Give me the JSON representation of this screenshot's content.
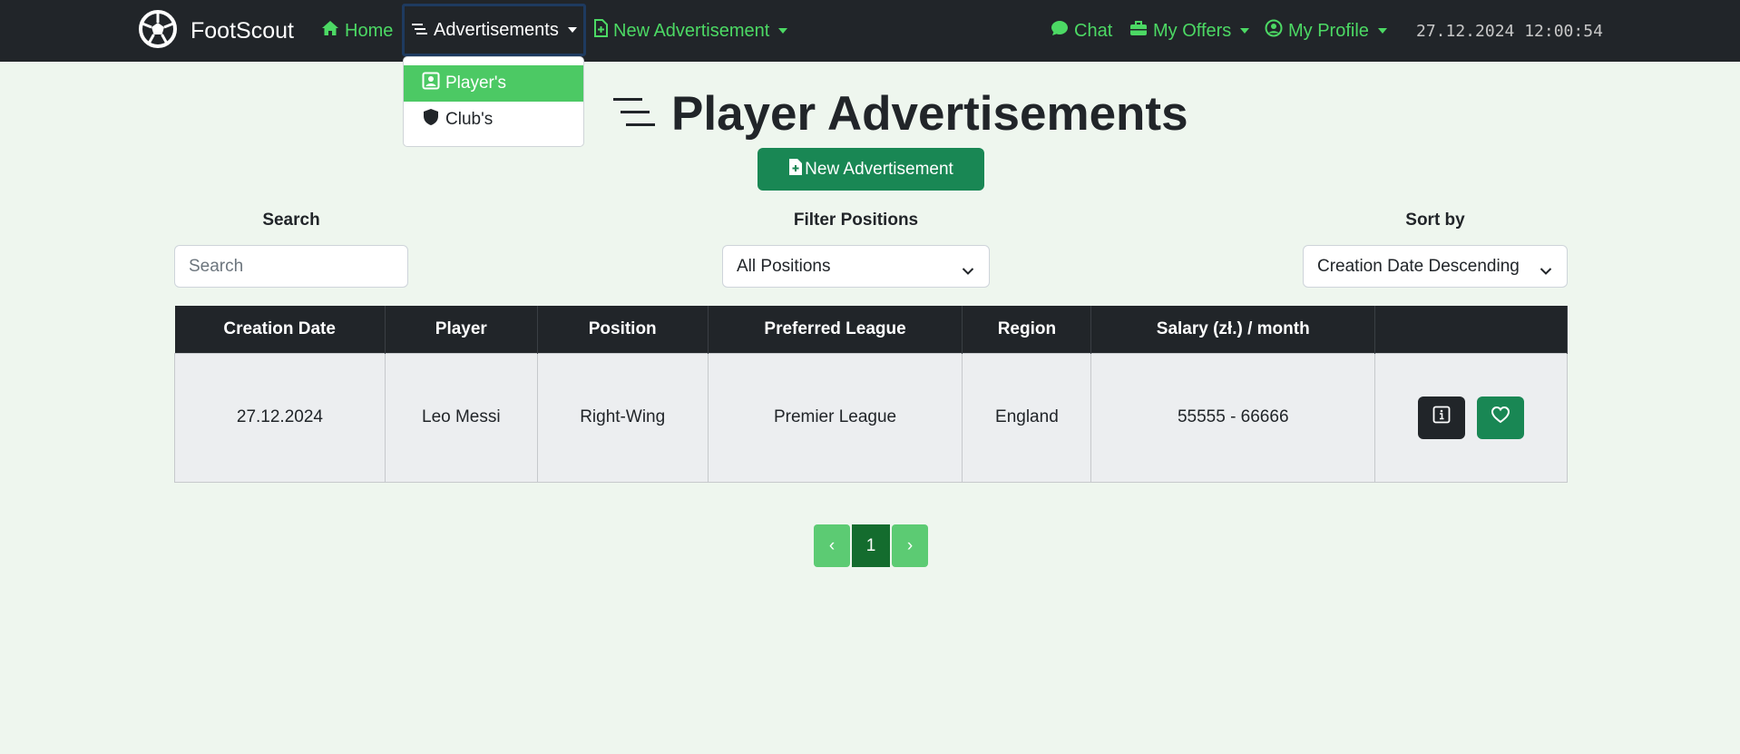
{
  "app": {
    "brand": "FootScout",
    "clock": "27.12.2024 12:00:54"
  },
  "nav": {
    "home": "Home",
    "advertisements": "Advertisements",
    "new_advertisement": "New Advertisement",
    "chat": "Chat",
    "my_offers": "My Offers",
    "my_profile": "My Profile"
  },
  "dropdown": {
    "items": [
      {
        "label": "Player's",
        "active": true
      },
      {
        "label": "Club's",
        "active": false
      }
    ]
  },
  "page": {
    "title": "Player Advertisements",
    "new_button": "New Advertisement"
  },
  "filters": {
    "search_label": "Search",
    "search_placeholder": "Search",
    "positions_label": "Filter Positions",
    "positions_value": "All Positions",
    "sort_label": "Sort by",
    "sort_value": "Creation Date Descending"
  },
  "table": {
    "headers": [
      "Creation Date",
      "Player",
      "Position",
      "Preferred League",
      "Region",
      "Salary (zł.) / month",
      ""
    ],
    "rows": [
      {
        "date": "27.12.2024",
        "player": "Leo Messi",
        "position": "Right-Wing",
        "league": "Premier League",
        "region": "England",
        "salary": "55555 - 66666"
      }
    ]
  },
  "pagination": {
    "prev": "‹",
    "current": "1",
    "next": "›"
  },
  "colors": {
    "accent": "#4cd964",
    "primary_green": "#198754",
    "navbar": "#212529",
    "background": "#eef6ee"
  }
}
